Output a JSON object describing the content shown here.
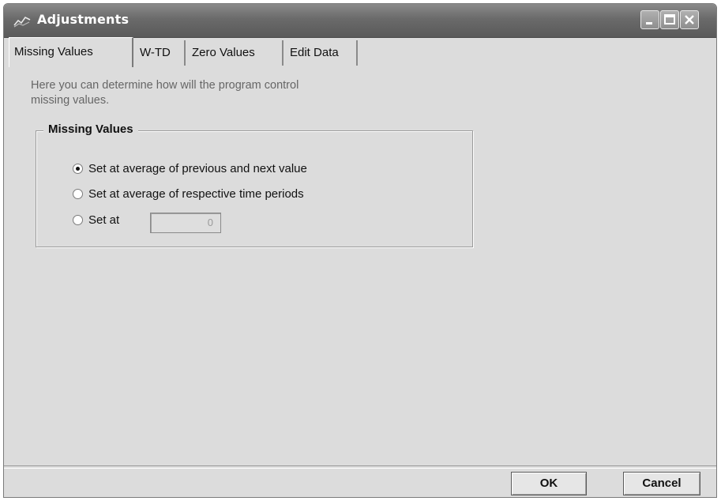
{
  "window": {
    "title": "Adjustments",
    "icon": "line-chart-icon",
    "controls": [
      "minimize-icon",
      "maximize-icon",
      "close-icon"
    ]
  },
  "tabs": [
    {
      "label": "Missing Values",
      "active": true
    },
    {
      "label": "W-TD",
      "active": false
    },
    {
      "label": "Zero Values",
      "active": false
    },
    {
      "label": "Edit Data",
      "active": false
    }
  ],
  "panel": {
    "intro_line1": "Here you can determine how will the program control",
    "intro_line2": "missing values.",
    "group_title": "Missing Values",
    "options": [
      {
        "label": "Set at average of previous and next value",
        "selected": true
      },
      {
        "label": "Set at average of respective time periods",
        "selected": false
      },
      {
        "label": "Set at",
        "selected": false
      }
    ],
    "set_at_value": "0"
  },
  "buttons": {
    "ok": "OK",
    "cancel": "Cancel"
  }
}
